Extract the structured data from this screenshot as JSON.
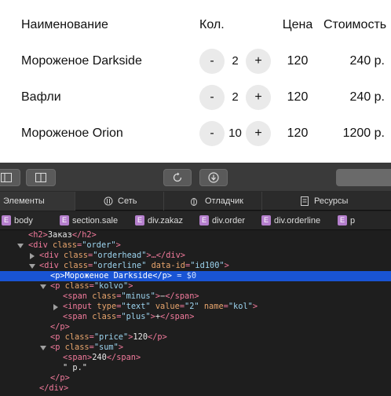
{
  "table": {
    "headers": {
      "name": "Наименование",
      "qty": "Кол.",
      "price": "Цена",
      "sum": "Стоимость"
    },
    "rows": [
      {
        "name": "Мороженое Darkside",
        "minus": "-",
        "qty": "2",
        "plus": "+",
        "price": "120",
        "sum": "240 р."
      },
      {
        "name": "Вафли",
        "minus": "-",
        "qty": "2",
        "plus": "+",
        "price": "120",
        "sum": "240 р."
      },
      {
        "name": "Мороженое Orion",
        "minus": "-",
        "qty": "10",
        "plus": "+",
        "price": "120",
        "sum": "1200 р."
      }
    ]
  },
  "devtools": {
    "toolbar_icons": [
      "sidebar-left-icon",
      "layout-icon",
      "reload-icon",
      "download-icon"
    ],
    "tabs": [
      {
        "label": "Элементы",
        "icon": "elements-icon"
      },
      {
        "label": "Сеть",
        "icon": "network-icon"
      },
      {
        "label": "Отладчик",
        "icon": "debugger-icon"
      },
      {
        "label": "Ресурсы",
        "icon": "resources-icon"
      }
    ],
    "breadcrumbs": [
      {
        "badge": "E",
        "label": "body"
      },
      {
        "badge": "E",
        "label": "section.sale"
      },
      {
        "badge": "E",
        "label": "div.zakaz"
      },
      {
        "badge": "E",
        "label": "div.order"
      },
      {
        "badge": "E",
        "label": "div.orderline"
      },
      {
        "badge": "E",
        "label": "p"
      }
    ],
    "dom": {
      "l0_tag_open": "<h2>",
      "l0_text": "Заказ",
      "l0_tag_close": "</h2>",
      "l1_tag": "<div ",
      "l1_attr": "class",
      "l1_val": "\"order\"",
      "l1_end": ">",
      "l2_tag": "<div ",
      "l2_attr": "class",
      "l2_val": "\"orderhead\"",
      "l2_end": ">…</div>",
      "l3_tag": "<div ",
      "l3_attr": "class",
      "l3_val": "\"orderline\"",
      "l3_attr2": "data-id",
      "l3_val2": "\"id100\"",
      "l3_end": ">",
      "l4_tag_open": "<p>",
      "l4_text": "Мороженое Darkside",
      "l4_tag_close": "</p>",
      "l4_eq": " = $0",
      "l5_tag": "<p ",
      "l5_attr": "class",
      "l5_val": "\"kolvo\"",
      "l5_end": ">",
      "l6_tag": "<span ",
      "l6_attr": "class",
      "l6_val": "\"minus\"",
      "l6_gt": ">",
      "l6_text": "−",
      "l6_end": "</span>",
      "l7_tag": "<input ",
      "l7_a1": "type",
      "l7_v1": "\"text\"",
      "l7_a2": "value",
      "l7_v2": "\"2\"",
      "l7_a3": "name",
      "l7_v3": "\"kol\"",
      "l7_end": ">",
      "l8_tag": "<span ",
      "l8_attr": "class",
      "l8_val": "\"plus\"",
      "l8_gt": ">",
      "l8_text": "+",
      "l8_end": "</span>",
      "l9_tag": "</p>",
      "l10_tag": "<p ",
      "l10_attr": "class",
      "l10_val": "\"price\"",
      "l10_gt": ">",
      "l10_text": "120",
      "l10_end": "</p>",
      "l11_tag": "<p ",
      "l11_attr": "class",
      "l11_val": "\"sum\"",
      "l11_end": ">",
      "l12_tag_open": "<span>",
      "l12_text": "240",
      "l12_tag_close": "</span>",
      "l13_text": "\" р.\"",
      "l14_tag": "</p>",
      "l15_tag": "</div>"
    }
  },
  "colors": {
    "selection": "#1954d4",
    "tag": "#f27a9c",
    "attribute": "#e8a56d",
    "value": "#9cd3ee",
    "badge": "#b57fcd"
  }
}
